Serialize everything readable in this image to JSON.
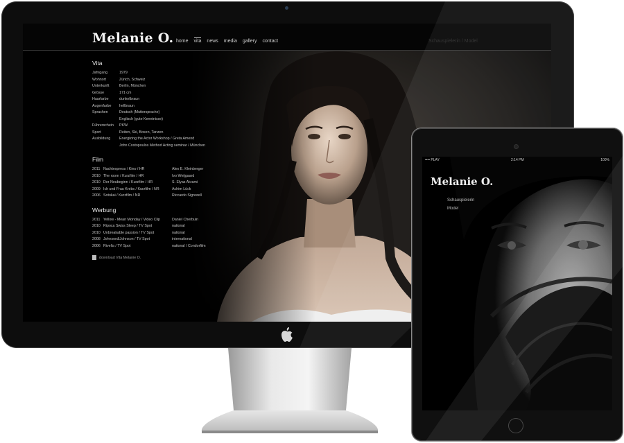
{
  "desktop": {
    "brand": "Melanie O.",
    "nav": [
      "home",
      "vita",
      "news",
      "media",
      "gallery",
      "contact"
    ],
    "nav_active": "vita",
    "header_faded_text": "Schauspielerin / Model",
    "vita": {
      "title": "Vita",
      "facts": [
        {
          "k": "Jahrgang",
          "v": "1979"
        },
        {
          "k": "Wohnort",
          "v": "Zürich, Schweiz"
        },
        {
          "k": "Unterkunft",
          "v": "Berlin, München"
        },
        {
          "k": "Grösse",
          "v": "171 cm"
        },
        {
          "k": "Haarfarbe",
          "v": "dunkelbraun"
        },
        {
          "k": "Augenfarbe",
          "v": "hellbraun"
        },
        {
          "k": "Sprachen",
          "v": "Deutsch (Muttersprache)"
        },
        {
          "k": "",
          "v": "Englisch (gute Kenntnisse)"
        },
        {
          "k": "Führerschein",
          "v": "PKW"
        },
        {
          "k": "Sport",
          "v": "Reiten, Ski, Boxen, Tanzen"
        },
        {
          "k": "Ausbildung",
          "v": "Energizing the Actor Workshop / Greta Amend"
        },
        {
          "k": "",
          "v": "John Costopoulos Method Acting seminar / München"
        }
      ]
    },
    "film": {
      "title": "Film",
      "rows": [
        {
          "y": "2011",
          "t": "Nachtexpress / Kino / HR",
          "p": "Alex E. Kleinberger"
        },
        {
          "y": "2010",
          "t": "The room / Kurzfilm / HR",
          "p": "Ivo Weijgaard"
        },
        {
          "y": "2010",
          "t": "Der Neubeginn / Kurzfilm / HR",
          "p": "S. Elyas Akrami"
        },
        {
          "y": "2009",
          "t": "Ich und Frau Krebs / Kurzfilm / NR",
          "p": "Achim Lück"
        },
        {
          "y": "2006",
          "t": "Sotokai / Kurzfilm / NR",
          "p": "Riccardo Signorell"
        }
      ]
    },
    "werbung": {
      "title": "Werbung",
      "rows": [
        {
          "y": "2011",
          "t": "Yellow - Mean Monday / Video Clip",
          "p": "Daniel Cherbuin"
        },
        {
          "y": "2010",
          "t": "Ripoca Swiss Sleep / TV Spot",
          "p": "national"
        },
        {
          "y": "2010",
          "t": "Unbreakable passion / TV Spot",
          "p": "national"
        },
        {
          "y": "2008",
          "t": "Johnson&Johnson / TV Spot",
          "p": "international"
        },
        {
          "y": "2006",
          "t": "Rivella / TV Spot",
          "p": "national / Condorfilm"
        }
      ]
    },
    "download_label": "download Vita Melanie O."
  },
  "tablet": {
    "status_left": "•••• PLAY",
    "status_time": "2:14 PM",
    "status_battery": "100%",
    "brand": "Melanie O.",
    "menu": [
      "Schauspielerin",
      "Model"
    ]
  }
}
